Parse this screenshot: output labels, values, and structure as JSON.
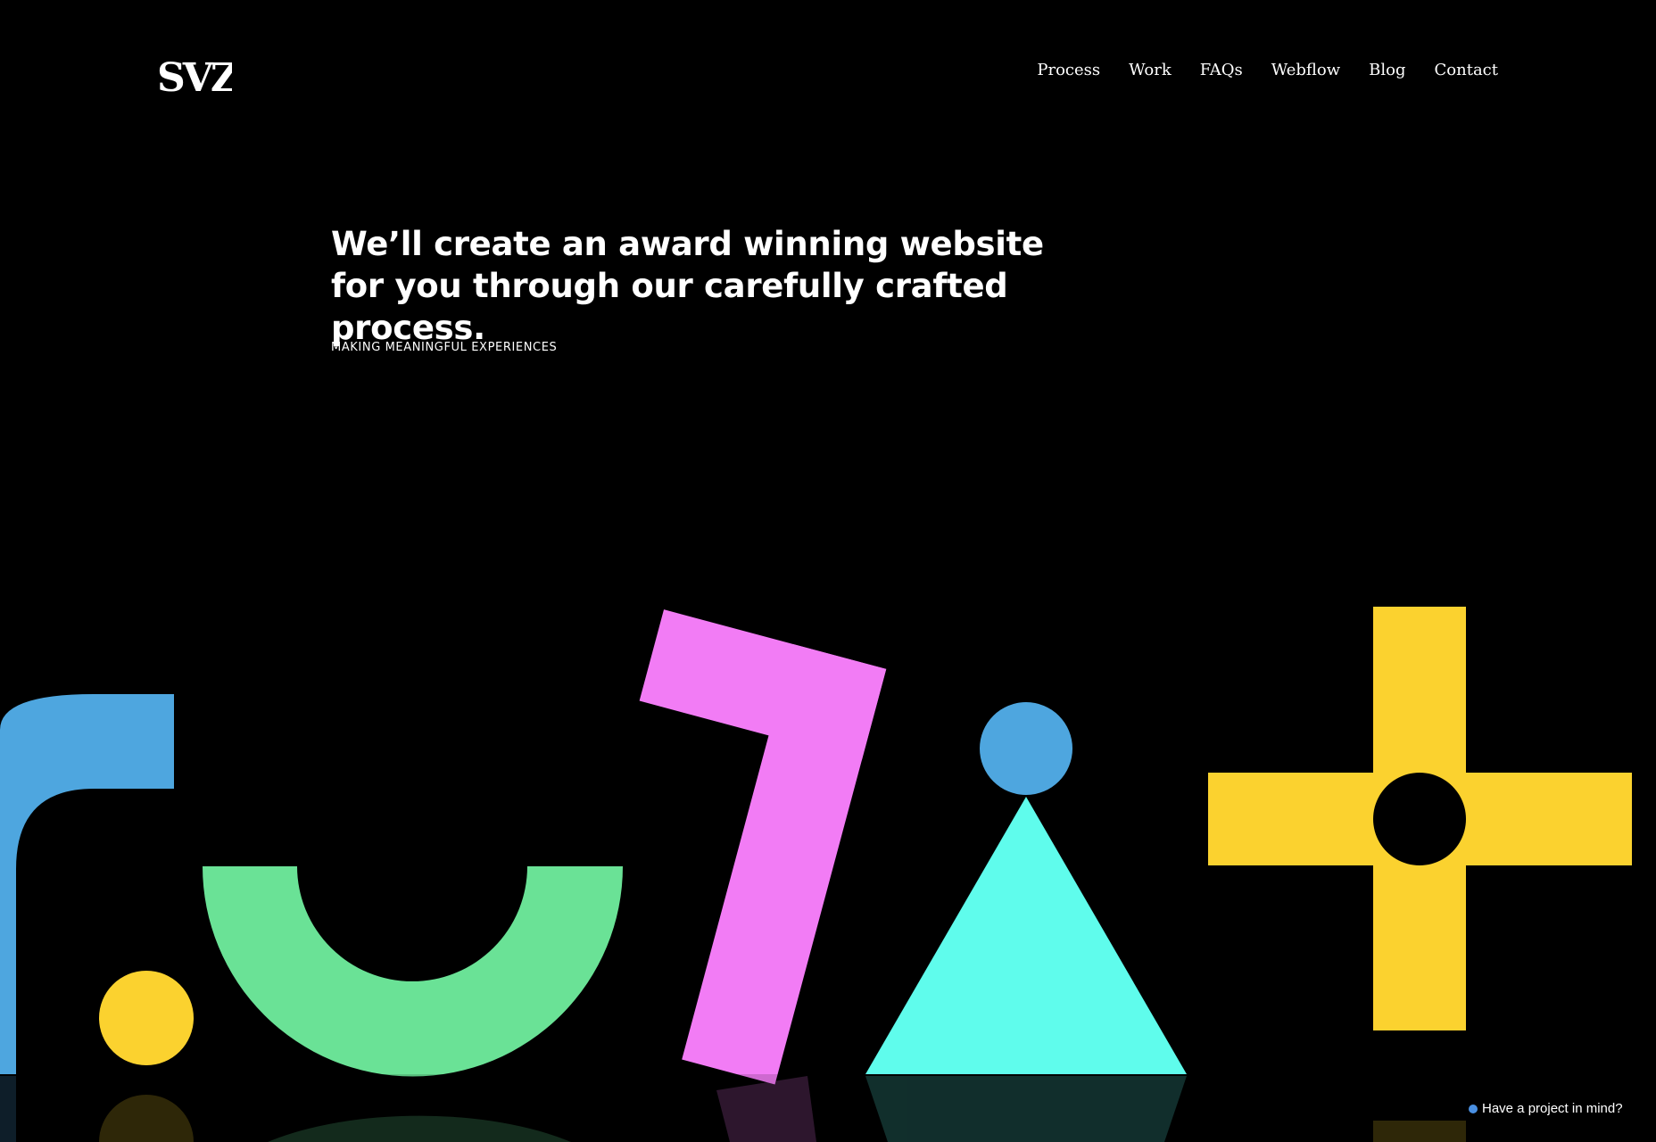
{
  "logo": {
    "text": "SVZ"
  },
  "nav": {
    "items": [
      {
        "label": "Process"
      },
      {
        "label": "Work"
      },
      {
        "label": "FAQs"
      },
      {
        "label": "Webflow"
      },
      {
        "label": "Blog"
      },
      {
        "label": "Contact"
      }
    ]
  },
  "hero": {
    "title": "We’ll create an award winning website for you through our carefully crafted process.",
    "subtitle": "MAKING MEANINGFUL EXPERIENCES"
  },
  "cta": {
    "label": "Have a project in mind?",
    "dot_color": "#4a90e2"
  },
  "colors": {
    "background": "#000000",
    "blue": "#4ea6df",
    "green": "#6ae296",
    "pink": "#f27cf5",
    "cyan": "#5ffcec",
    "yellow": "#fbd22f"
  }
}
